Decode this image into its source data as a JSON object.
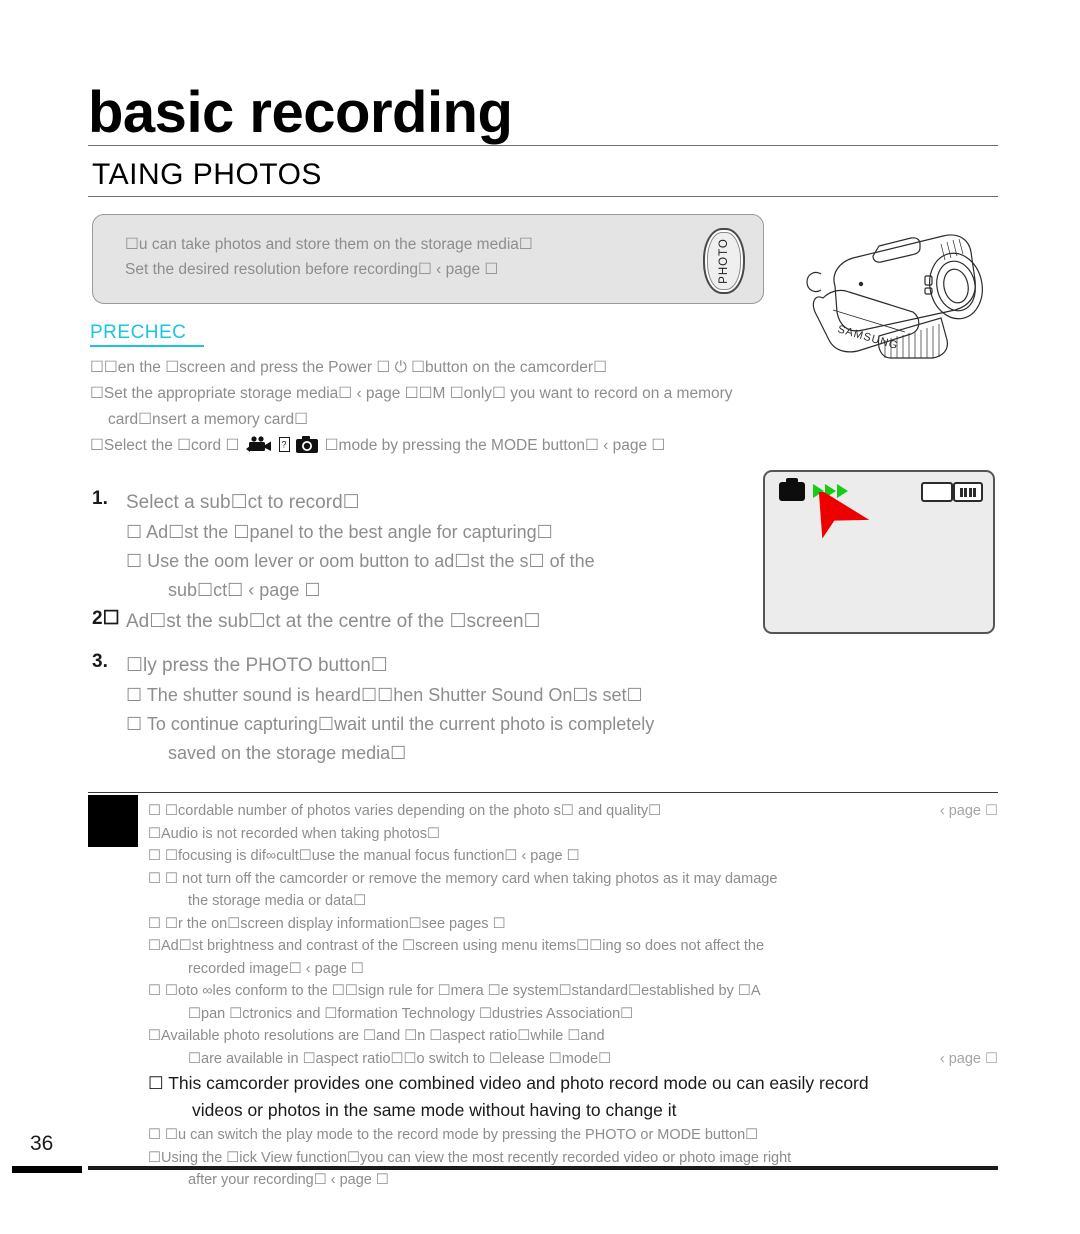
{
  "header": {
    "title": "basic recording",
    "subtitle": "TAING PHOTOS"
  },
  "callout": {
    "line1": "☐u can take photos and store them on the storage media☐",
    "line2": "Set the desired resolution before recording☐     ‹ page ☐",
    "button_label": "PHOTO"
  },
  "precheck": {
    "heading": "PRECHEC",
    "line1": "☐☐en the ☐screen and press the Power ☐            ⏻ ☐button on the camcorder☐",
    "line2": "☐Set the appropriate storage media☐        ‹ page ☐☐M ☐only☐ you want to record on a memory",
    "line2b": "card☐nsert a memory card☐",
    "line3_pre": "☐Select the ☐cord ☐",
    "line3_post": "☐mode by pressing the MODE button☐     ‹ page ☐"
  },
  "steps": [
    {
      "num": "1.",
      "text": "Select a sub☐ct to record☐",
      "subs": [
        "☐ Ad☐st the ☐panel to the best angle for capturing☐",
        "☐ Use the oom lever or oom button to ad☐st the s☐ of the",
        "sub☐ct☐  ‹ page ☐"
      ]
    },
    {
      "num": "2☐",
      "text": "Ad☐st the sub☐ct at the centre of the ☐screen☐",
      "subs": []
    },
    {
      "num": "3.",
      "text": "☐ly press the PHOTO button☐",
      "subs": [
        "☐ The shutter sound is heard☐☐hen Shutter Sound On☐s set☐",
        "☐ To continue capturing☐wait until the current photo is completely",
        "saved on the storage media☐"
      ]
    }
  ],
  "lcd": {
    "camera_icon": "camera-icon",
    "triangle_count": 3,
    "triangle_color": "#16cc16",
    "arrow_color": "#ee0000",
    "card_icon": "memory-card-icon",
    "battery_icon": "battery-icon"
  },
  "notes": [
    {
      "text": "☐ ☐cordable number of photos varies depending on the photo s☐ and quality☐",
      "page_ref": "‹ page ☐",
      "cont": "",
      "strong": false
    },
    {
      "text": "☐Audio is not recorded when taking photos☐",
      "page_ref": "",
      "cont": "",
      "strong": false
    },
    {
      "text": "☐ ☐focusing is dif∞cult☐use the manual focus function☐       ‹ page ☐",
      "page_ref": "",
      "cont": "",
      "strong": false
    },
    {
      "text": "☐ ☐ not turn off the camcorder or remove the memory card when taking photos as it may damage",
      "page_ref": "",
      "cont": "the storage media or data☐",
      "strong": false
    },
    {
      "text": "☐ ☐r the on☐screen display information☐see pages ☐",
      "page_ref": "",
      "cont": "",
      "strong": false
    },
    {
      "text": "☐Ad☐st brightness and contrast of the ☐screen using menu items☐☐ing so does not affect the",
      "page_ref": "",
      "cont": "recorded image☐    ‹ page ☐",
      "strong": false
    },
    {
      "text": "☐ ☐oto ∞les conform to the ☐☐sign rule for ☐mera ☐e system☐standard☐established by ☐A",
      "page_ref": "",
      "cont": "☐pan ☐ctronics and ☐formation Technology ☐dustries Association☐",
      "strong": false
    },
    {
      "text": "☐Available photo resolutions are ☐and ☐n ☐aspect ratio☐while ☐and",
      "page_ref": "",
      "cont": "☐are available in ☐aspect ratio☐☐o switch to ☐elease ☐mode☐",
      "cont_page_ref": "‹ page ☐",
      "strong": false
    },
    {
      "text": "☐  This camcorder provides one combined video and photo record mode ou can easily record",
      "page_ref": "",
      "cont": "videos or photos in the same mode without having to change it",
      "strong": true
    },
    {
      "text": "☐ ☐u can switch the play mode to the record mode by pressing the            PHOTO or MODE button☐",
      "page_ref": "",
      "cont": "",
      "strong": false
    },
    {
      "text": "☐Using the ☐ick View function☐you can view the most recently recorded video or photo image right",
      "page_ref": "",
      "cont": "after your recording☐    ‹ page ☐",
      "strong": false
    }
  ],
  "footer": {
    "page_number": "36"
  },
  "colors": {
    "accent": "#19c6e0",
    "body_text": "#8d8d8d",
    "strong_text": "#1a1a1a",
    "callout_bg": "#e4e4e4"
  }
}
